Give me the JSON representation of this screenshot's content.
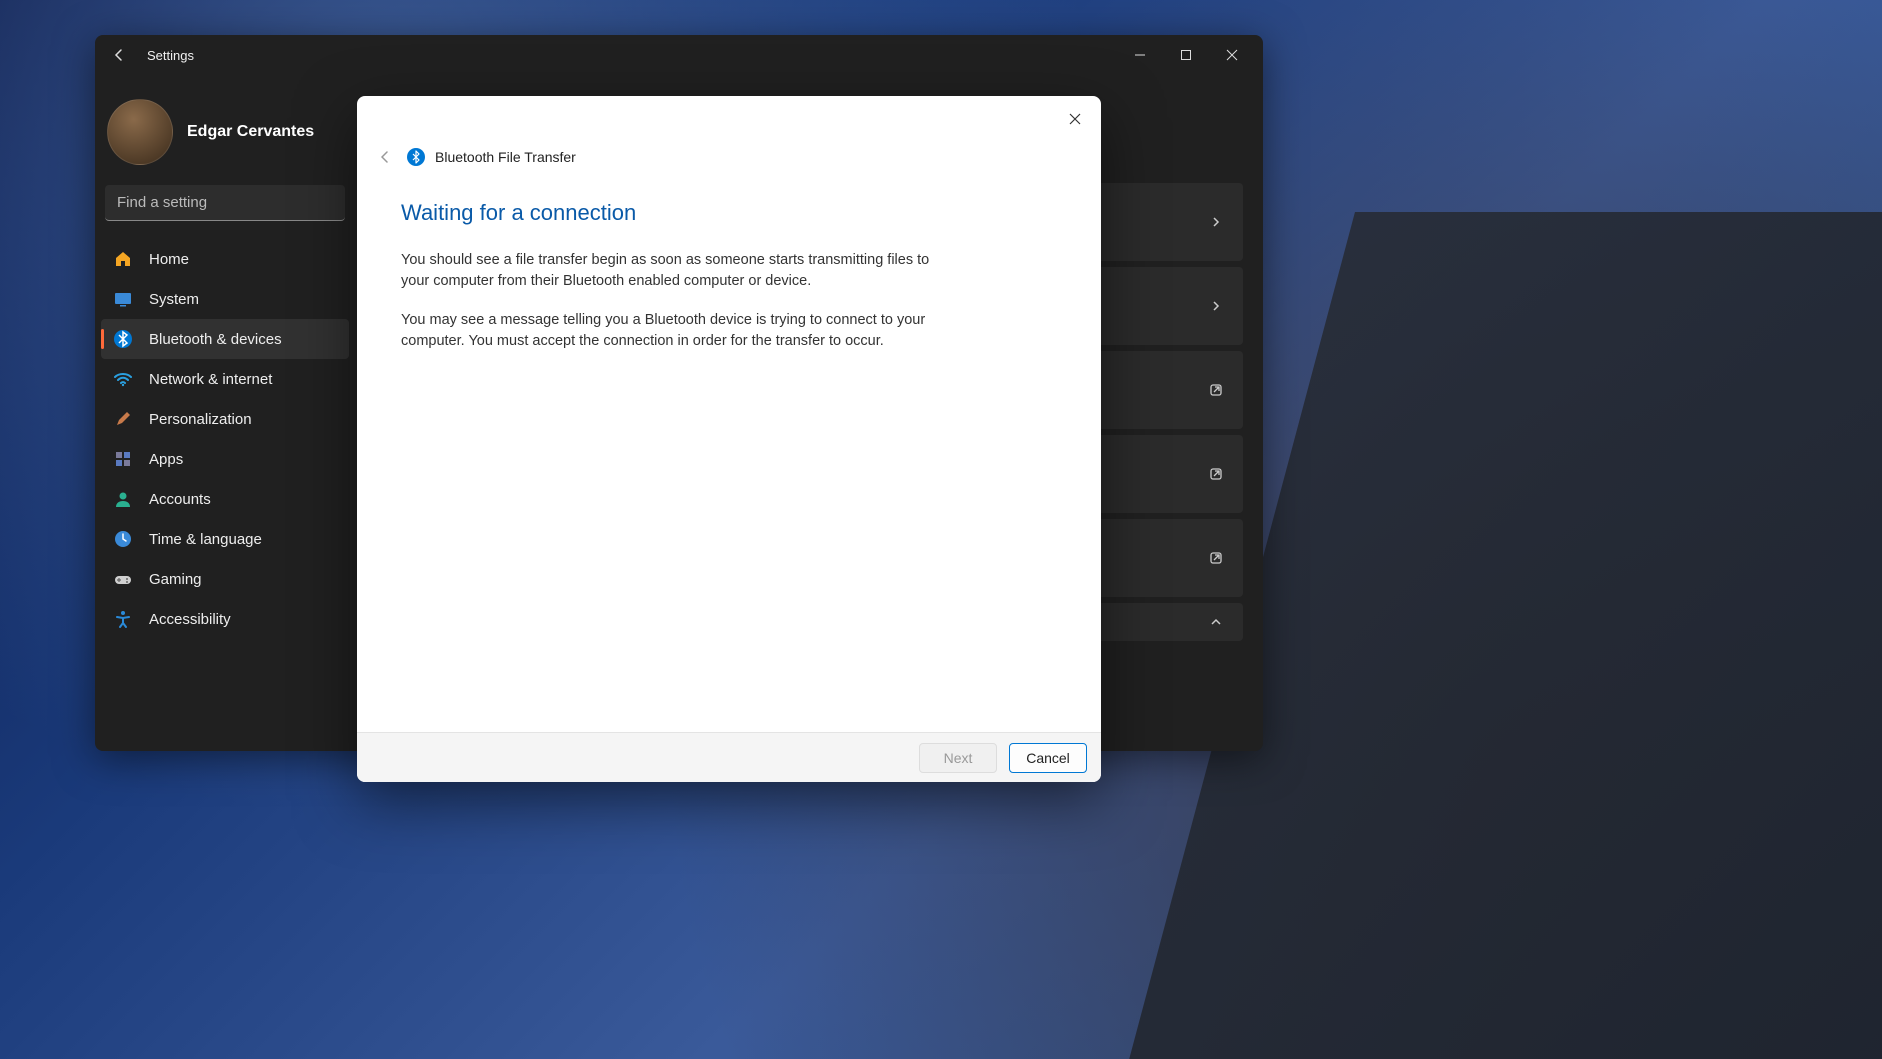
{
  "window": {
    "title": "Settings"
  },
  "profile": {
    "name": "Edgar Cervantes"
  },
  "search": {
    "placeholder": "Find a setting"
  },
  "sidebar": {
    "items": [
      {
        "label": "Home",
        "icon": "home-icon",
        "color": "#f5a623"
      },
      {
        "label": "System",
        "icon": "system-icon",
        "color": "#3a8ad8"
      },
      {
        "label": "Bluetooth & devices",
        "icon": "bluetooth-icon",
        "color": "#0078d4",
        "active": true
      },
      {
        "label": "Network & internet",
        "icon": "wifi-icon",
        "color": "#2aa0e0"
      },
      {
        "label": "Personalization",
        "icon": "brush-icon",
        "color": "#c87a4a"
      },
      {
        "label": "Apps",
        "icon": "apps-icon",
        "color": "#7a7a9a"
      },
      {
        "label": "Accounts",
        "icon": "person-icon",
        "color": "#2ab090"
      },
      {
        "label": "Time & language",
        "icon": "clock-icon",
        "color": "#3a8ad8"
      },
      {
        "label": "Gaming",
        "icon": "gamepad-icon",
        "color": "#d0d0d0"
      },
      {
        "label": "Accessibility",
        "icon": "accessibility-icon",
        "color": "#2a8ad8"
      }
    ]
  },
  "dialog": {
    "title": "Bluetooth File Transfer",
    "heading": "Waiting for a connection",
    "para1": "You should see a file transfer begin as soon as someone starts transmitting files to your computer from their Bluetooth enabled computer or device.",
    "para2": "You may see a message telling you a Bluetooth device is trying to connect to your computer. You must accept the connection in order for the transfer to occur.",
    "next_label": "Next",
    "cancel_label": "Cancel"
  }
}
